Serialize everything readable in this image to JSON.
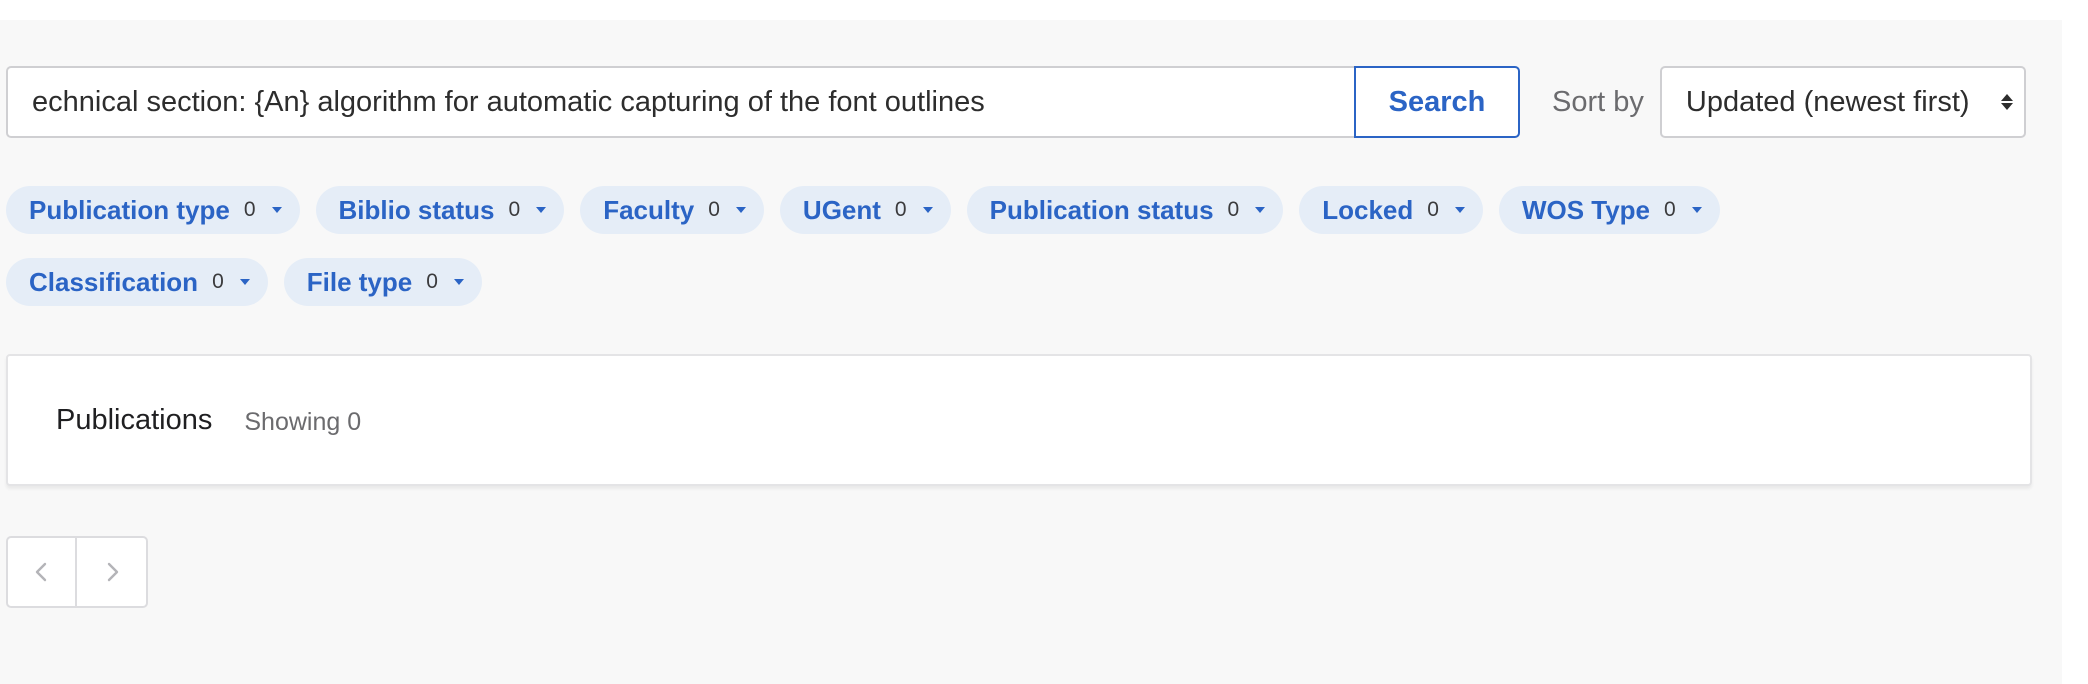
{
  "search": {
    "value": "echnical section: {An} algorithm for automatic capturing of the font outlines",
    "button_label": "Search"
  },
  "sort": {
    "label": "Sort by",
    "selected": "Updated (newest first)",
    "icon": "sort-arrows-icon"
  },
  "filters": {
    "row1": [
      {
        "label": "Publication type",
        "count": "0"
      },
      {
        "label": "Biblio status",
        "count": "0"
      },
      {
        "label": "Faculty",
        "count": "0"
      },
      {
        "label": "UGent",
        "count": "0"
      },
      {
        "label": "Publication status",
        "count": "0"
      },
      {
        "label": "Locked",
        "count": "0"
      },
      {
        "label": "WOS Type",
        "count": "0"
      }
    ],
    "row2": [
      {
        "label": "Classification",
        "count": "0"
      },
      {
        "label": "File type",
        "count": "0"
      }
    ],
    "caret_icon": "caret-down-icon"
  },
  "results": {
    "title": "Publications",
    "showing": "Showing 0"
  },
  "pagination": {
    "prev_icon": "chevron-left-icon",
    "next_icon": "chevron-right-icon"
  },
  "colors": {
    "accent": "#2b64c5",
    "chip_background": "#e5edf7",
    "page_background": "#f8f8f8"
  }
}
